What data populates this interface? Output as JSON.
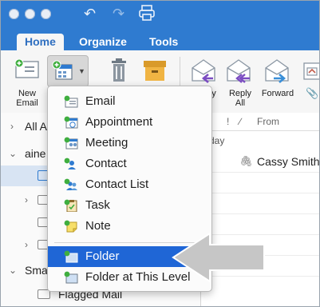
{
  "ribbon": {
    "tabs": [
      "Home",
      "Organize",
      "Tools"
    ],
    "new_email_label": "New Email",
    "reply_partial": "y",
    "reply_all_label": "Reply All",
    "forward_label": "Forward"
  },
  "folders": {
    "all_accounts": "All A",
    "account": "aine",
    "smart": "Sma",
    "flagged": "Flagged Mail"
  },
  "list": {
    "header_from": "From",
    "group_label": "day",
    "sender": "Cassy Smith"
  },
  "menu": {
    "items": [
      {
        "label": "Email",
        "icon": "email-icon"
      },
      {
        "label": "Appointment",
        "icon": "appointment-icon"
      },
      {
        "label": "Meeting",
        "icon": "meeting-icon"
      },
      {
        "label": "Contact",
        "icon": "contact-icon"
      },
      {
        "label": "Contact List",
        "icon": "contact-list-icon"
      },
      {
        "label": "Task",
        "icon": "task-icon"
      },
      {
        "label": "Note",
        "icon": "note-icon"
      },
      {
        "label": "Folder",
        "icon": "folder-icon"
      },
      {
        "label": "Folder at This Level",
        "icon": "folder-at-level-icon"
      }
    ],
    "highlighted": "Folder"
  },
  "colors": {
    "brand_blue": "#2f7bd0",
    "highlight_blue": "#1f66d6",
    "arrow_gray": "#c6c6c6"
  }
}
